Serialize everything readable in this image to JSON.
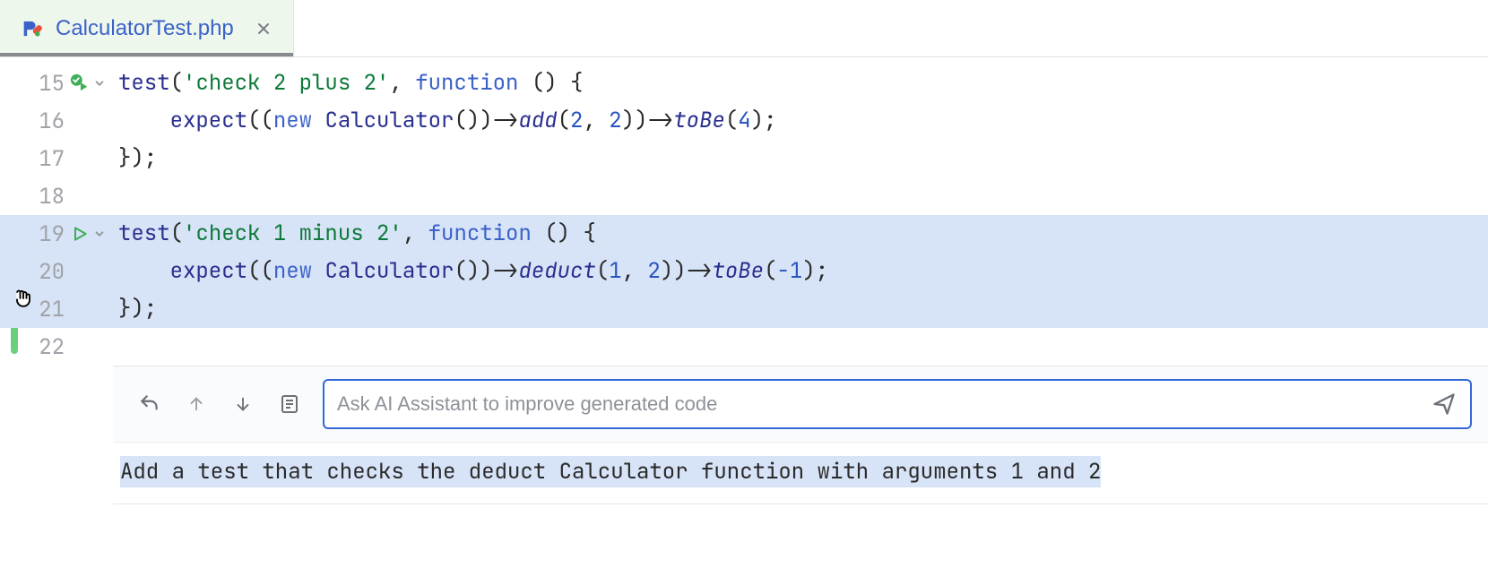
{
  "tab": {
    "filename": "CalculatorTest.php",
    "file_icon": "pest-icon"
  },
  "gutter": {
    "change_stripes": [
      {
        "color": "#7a5fd6",
        "top_line_index": 4,
        "height_lines": 2.3
      },
      {
        "color": "#6bcf7d",
        "top_line_index": 6.3,
        "height_lines": 1.4
      }
    ]
  },
  "lines": [
    {
      "num": 15,
      "run": "green-check-play",
      "fold": true,
      "hl": false,
      "tokens": [
        {
          "t": "test",
          "c": "tok-fn"
        },
        {
          "t": "(",
          "c": "tok-punc"
        },
        {
          "t": "'check 2 plus 2'",
          "c": "tok-str"
        },
        {
          "t": ", ",
          "c": "tok-punc"
        },
        {
          "t": "function",
          "c": "tok-kw"
        },
        {
          "t": " () {",
          "c": "tok-punc"
        }
      ]
    },
    {
      "num": 16,
      "run": null,
      "fold": false,
      "hl": false,
      "tokens": [
        {
          "t": "    ",
          "c": "tok-plain"
        },
        {
          "t": "expect",
          "c": "tok-fn"
        },
        {
          "t": "((",
          "c": "tok-punc"
        },
        {
          "t": "new ",
          "c": "tok-kw2"
        },
        {
          "t": "Calculator",
          "c": "tok-fn"
        },
        {
          "t": "())->",
          "c": "tok-arrow"
        },
        {
          "t": "add",
          "c": "tok-id"
        },
        {
          "t": "(",
          "c": "tok-punc"
        },
        {
          "t": "2",
          "c": "tok-num"
        },
        {
          "t": ", ",
          "c": "tok-punc"
        },
        {
          "t": "2",
          "c": "tok-num"
        },
        {
          "t": "))->",
          "c": "tok-arrow"
        },
        {
          "t": "toBe",
          "c": "tok-id"
        },
        {
          "t": "(",
          "c": "tok-punc"
        },
        {
          "t": "4",
          "c": "tok-num"
        },
        {
          "t": ");",
          "c": "tok-punc"
        }
      ]
    },
    {
      "num": 17,
      "run": null,
      "fold": false,
      "hl": false,
      "tokens": [
        {
          "t": "});",
          "c": "tok-punc"
        }
      ]
    },
    {
      "num": 18,
      "run": null,
      "fold": false,
      "hl": false,
      "tokens": [
        {
          "t": "",
          "c": "tok-plain"
        }
      ]
    },
    {
      "num": 19,
      "run": "play",
      "fold": true,
      "hl": true,
      "tokens": [
        {
          "t": "test",
          "c": "tok-fn"
        },
        {
          "t": "(",
          "c": "tok-punc"
        },
        {
          "t": "'check 1 minus 2'",
          "c": "tok-str"
        },
        {
          "t": ", ",
          "c": "tok-punc"
        },
        {
          "t": "function",
          "c": "tok-kw"
        },
        {
          "t": " () {",
          "c": "tok-punc"
        }
      ]
    },
    {
      "num": 20,
      "run": null,
      "fold": false,
      "hl": true,
      "tokens": [
        {
          "t": "    ",
          "c": "tok-plain"
        },
        {
          "t": "expect",
          "c": "tok-fn"
        },
        {
          "t": "((",
          "c": "tok-punc"
        },
        {
          "t": "new ",
          "c": "tok-kw2"
        },
        {
          "t": "Calculator",
          "c": "tok-fn"
        },
        {
          "t": "())->",
          "c": "tok-arrow"
        },
        {
          "t": "deduct",
          "c": "tok-id"
        },
        {
          "t": "(",
          "c": "tok-punc"
        },
        {
          "t": "1",
          "c": "tok-num"
        },
        {
          "t": ", ",
          "c": "tok-punc"
        },
        {
          "t": "2",
          "c": "tok-num"
        },
        {
          "t": "))->",
          "c": "tok-arrow"
        },
        {
          "t": "toBe",
          "c": "tok-id"
        },
        {
          "t": "(",
          "c": "tok-punc"
        },
        {
          "t": "-1",
          "c": "tok-num"
        },
        {
          "t": ");",
          "c": "tok-punc"
        }
      ]
    },
    {
      "num": 21,
      "run": null,
      "fold": false,
      "hl": true,
      "tokens": [
        {
          "t": "});",
          "c": "tok-punc"
        }
      ]
    },
    {
      "num": 22,
      "run": null,
      "fold": false,
      "hl": false,
      "tokens": [
        {
          "t": "",
          "c": "tok-plain"
        }
      ]
    }
  ],
  "ai_panel": {
    "placeholder": "Ask AI Assistant to improve generated code",
    "last_prompt": "Add a test that checks the deduct Calculator function with arguments 1 and 2"
  },
  "icons": {
    "undo": "undo-icon",
    "up": "arrow-up-icon",
    "down": "arrow-down-icon",
    "diff": "diff-icon",
    "send": "send-icon"
  }
}
